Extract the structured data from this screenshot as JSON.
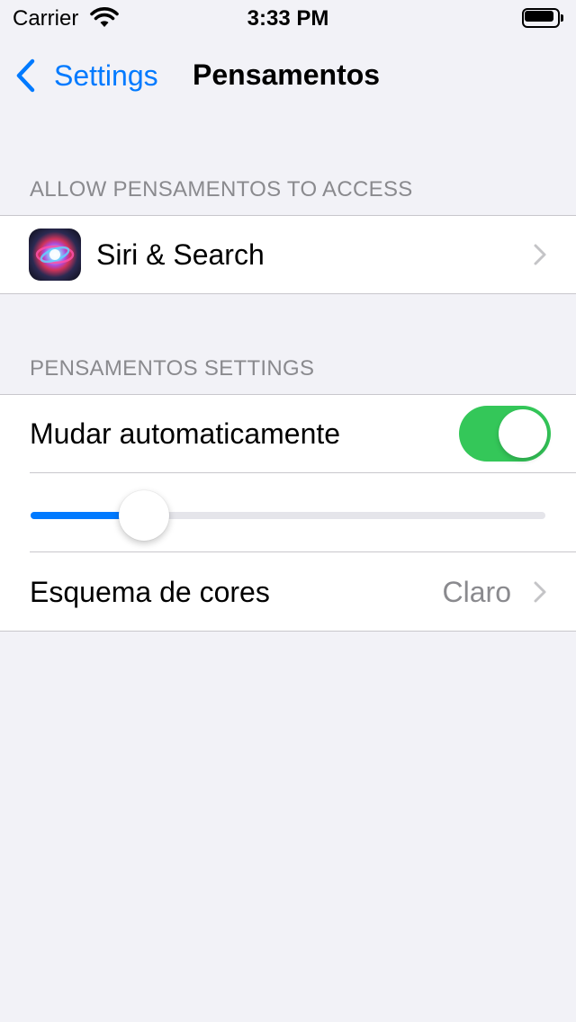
{
  "status_bar": {
    "carrier": "Carrier",
    "time": "3:33 PM",
    "wifi_icon": "wifi-icon",
    "battery_icon": "battery-icon"
  },
  "nav": {
    "back_label": "Settings",
    "title": "Pensamentos",
    "back_icon": "chevron-left-icon"
  },
  "access_section": {
    "header": "ALLOW PENSAMENTOS TO ACCESS",
    "items": [
      {
        "label": "Siri & Search",
        "icon": "siri-icon"
      }
    ]
  },
  "settings_section": {
    "header": "PENSAMENTOS SETTINGS",
    "auto_switch": {
      "label": "Mudar automaticamente",
      "on": true
    },
    "slider": {
      "value": 0.19
    },
    "color_scheme": {
      "label": "Esquema de cores",
      "value": "Claro"
    }
  },
  "colors": {
    "accent": "#007aff",
    "toggle_on": "#34c759",
    "background": "#f2f2f7",
    "secondary_text": "#8a8a8e"
  }
}
